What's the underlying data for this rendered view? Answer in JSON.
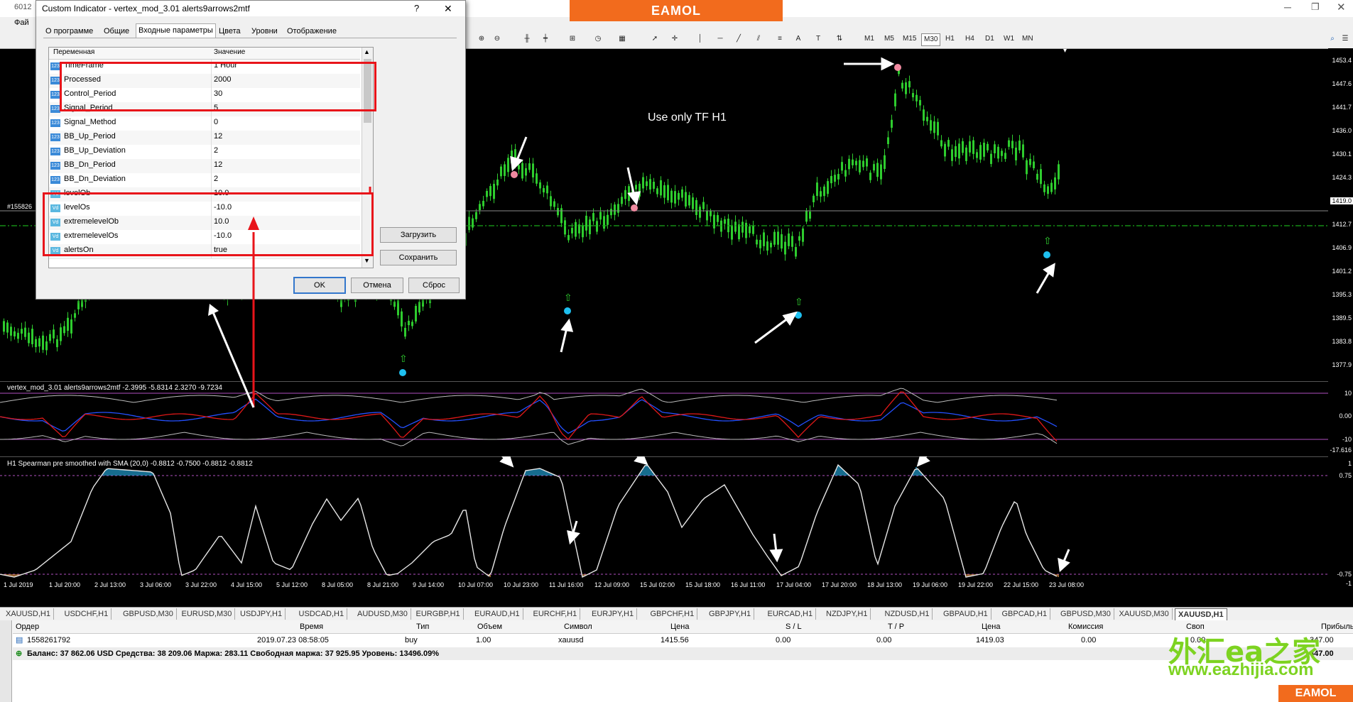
{
  "window": {
    "title_fragment": "6012",
    "menu_fragment": "Фай"
  },
  "brand": {
    "top_logo": "EAMOL",
    "bottom_logo": "EAMOL",
    "watermark_cn": "外汇ea之家",
    "watermark_url": "www.eazhijia.com"
  },
  "toolbar": {
    "timeframes": [
      "M1",
      "M5",
      "M15",
      "M30",
      "H1",
      "H4",
      "D1",
      "W1",
      "MN"
    ],
    "active_timeframe": "M30",
    "tool_letters": [
      "A",
      "T"
    ]
  },
  "dialog": {
    "title": "Custom Indicator - vertex_mod_3.01 alerts9arrows2mtf",
    "help": "?",
    "close": "✕",
    "tabs": [
      "О программе",
      "Общие",
      "Входные параметры",
      "Цвета",
      "Уровни",
      "Отображение"
    ],
    "active_tab": "Входные параметры",
    "col_variable": "Переменная",
    "col_value": "Значение",
    "params": [
      {
        "name": "TimeFrame",
        "value": "1 Hour",
        "type": "123"
      },
      {
        "name": "Processed",
        "value": "2000",
        "type": "123"
      },
      {
        "name": "Control_Period",
        "value": "30",
        "type": "123"
      },
      {
        "name": "Signal_Period",
        "value": "5",
        "type": "123"
      },
      {
        "name": "Signal_Method",
        "value": "0",
        "type": "123"
      },
      {
        "name": "BB_Up_Period",
        "value": "12",
        "type": "123"
      },
      {
        "name": "BB_Up_Deviation",
        "value": "2",
        "type": "123"
      },
      {
        "name": "BB_Dn_Period",
        "value": "12",
        "type": "123"
      },
      {
        "name": "BB_Dn_Deviation",
        "value": "2",
        "type": "123"
      },
      {
        "name": "levelOb",
        "value": "10.0",
        "type": "lv"
      },
      {
        "name": "levelOs",
        "value": "-10.0",
        "type": "lv"
      },
      {
        "name": "extremelevelOb",
        "value": "10.0",
        "type": "lv"
      },
      {
        "name": "extremelevelOs",
        "value": "-10.0",
        "type": "lv"
      },
      {
        "name": "alertsOn",
        "value": "true",
        "type": "lv"
      }
    ],
    "btn_load": "Загрузить",
    "btn_save": "Сохранить",
    "btn_ok": "OK",
    "btn_cancel": "Отмена",
    "btn_reset": "Сброс"
  },
  "main_chart": {
    "annotation": "Use only TF  H1",
    "left_label": "#155826",
    "price_labels": [
      "1453.4",
      "1447.6",
      "1441.7",
      "1436.0",
      "1430.1",
      "1424.3",
      "1419.0",
      "1412.7",
      "1406.9",
      "1401.2",
      "1395.3",
      "1389.5",
      "1383.8",
      "1377.9"
    ],
    "current_price": "1419.0"
  },
  "indicator1": {
    "label": "vertex_mod_3.01 alerts9arrows2mtf -2.3995 -5.8314 2.3270 -9.7234",
    "scale": [
      "10",
      "0.00",
      "-10",
      "-17.616"
    ]
  },
  "indicator2": {
    "label": "H1 Spearman pre smoothed with SMA (20,0) -0.8812 -0.7500 -0.8812 -0.8812",
    "scale": [
      "1",
      "0.75",
      "-0.75",
      "-1"
    ]
  },
  "time_axis": [
    "1 Jul 2019",
    "1 Jul 20:00",
    "2 Jul 13:00",
    "3 Jul 06:00",
    "3 Jul 22:00",
    "4 Jul 15:00",
    "5 Jul 12:00",
    "8 Jul 05:00",
    "8 Jul 21:00",
    "9 Jul 14:00",
    "10 Jul 07:00",
    "10 Jul 23:00",
    "11 Jul 16:00",
    "12 Jul 09:00",
    "15 Jul 02:00",
    "15 Jul 18:00",
    "16 Jul 11:00",
    "17 Jul 04:00",
    "17 Jul 20:00",
    "18 Jul 13:00",
    "19 Jul 06:00",
    "19 Jul 22:00",
    "22 Jul 15:00",
    "23 Jul 08:00"
  ],
  "symbol_tabs": [
    "XAUUSD,H1",
    "USDCHF,H1",
    "GBPUSD,M30",
    "EURUSD,M30",
    "USDJPY,H1",
    "USDCAD,H1",
    "AUDUSD,M30",
    "EURGBP,H1",
    "EURAUD,H1",
    "EURCHF,H1",
    "EURJPY,H1",
    "GBPCHF,H1",
    "GBPJPY,H1",
    "EURCAD,H1",
    "NZDJPY,H1",
    "NZDUSD,H1",
    "GBPAUD,H1",
    "GBPCAD,H1",
    "GBPUSD,M30",
    "XAUUSD,M30",
    "XAUUSD,H1"
  ],
  "active_symbol_tab": "XAUUSD,H1",
  "terminal": {
    "headers": [
      "Ордер",
      "Время",
      "Тип",
      "Объем",
      "Символ",
      "Цена",
      "S / L",
      "T / P",
      "Цена",
      "Комиссия",
      "Своп",
      "Прибыль"
    ],
    "order": {
      "id": "1558261792",
      "time": "2019.07.23 08:58:05",
      "type": "buy",
      "volume": "1.00",
      "symbol": "xauusd",
      "price": "1415.56",
      "sl": "0.00",
      "tp": "0.00",
      "cur_price": "1419.03",
      "commission": "0.00",
      "swap": "0.00",
      "profit": "347.00"
    },
    "balance_line": "Баланс: 37 862.06 USD  Средства: 38 209.06  Маржа: 283.11  Свободная маржа: 37 925.95  Уровень: 13496.09%",
    "total_profit": "347.00"
  }
}
